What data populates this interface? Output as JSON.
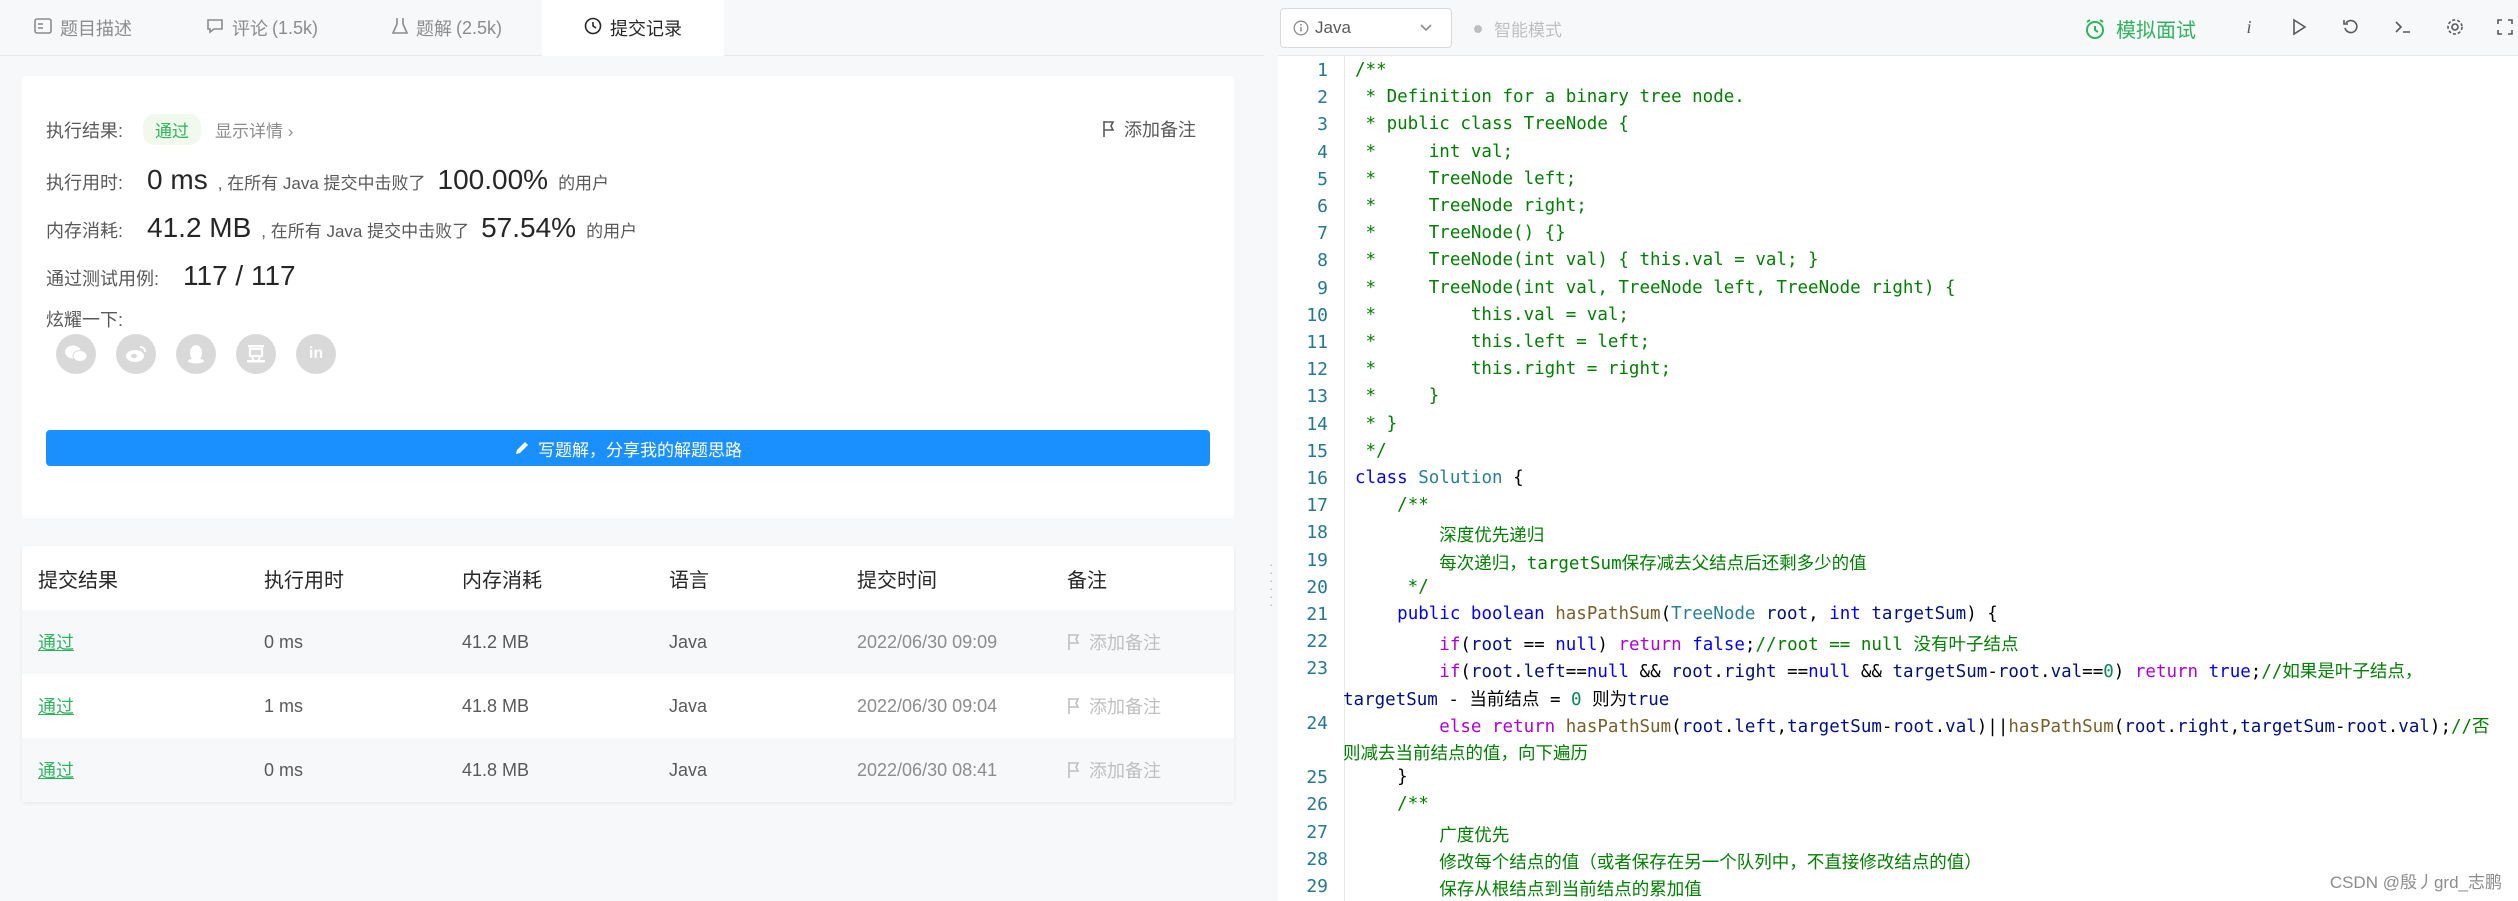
{
  "tabs": [
    {
      "label": "题目描述",
      "count": ""
    },
    {
      "label": "评论",
      "count": "(1.5k)"
    },
    {
      "label": "题解",
      "count": "(2.5k)"
    },
    {
      "label": "提交记录",
      "count": ""
    }
  ],
  "result": {
    "status_label": "执行结果:",
    "status_value": "通过",
    "detail_link": "显示详情 ›",
    "add_note": "添加备注",
    "runtime_label": "执行用时:",
    "runtime_value": "0 ms",
    "runtime_text": ", 在所有 Java 提交中击败了",
    "runtime_pct": "100.00%",
    "runtime_suffix": "的用户",
    "memory_label": "内存消耗:",
    "memory_value": "41.2 MB",
    "memory_text": ", 在所有 Java 提交中击败了",
    "memory_pct": "57.54%",
    "memory_suffix": "的用户",
    "tests_label": "通过测试用例:",
    "tests_value": "117 / 117",
    "share_label": "炫耀一下:",
    "write_button": "写题解，分享我的解题思路"
  },
  "share_icons": [
    "wechat-icon",
    "weibo-icon",
    "qq-icon",
    "douban-icon",
    "linkedin-icon"
  ],
  "table": {
    "headers": [
      "提交结果",
      "执行用时",
      "内存消耗",
      "语言",
      "提交时间",
      "备注"
    ],
    "rows": [
      {
        "result": "通过",
        "time": "0 ms",
        "memory": "41.2 MB",
        "lang": "Java",
        "submitted": "2022/06/30 09:09",
        "note": "添加备注"
      },
      {
        "result": "通过",
        "time": "1 ms",
        "memory": "41.8 MB",
        "lang": "Java",
        "submitted": "2022/06/30 09:04",
        "note": "添加备注"
      },
      {
        "result": "通过",
        "time": "0 ms",
        "memory": "41.8 MB",
        "lang": "Java",
        "submitted": "2022/06/30 08:41",
        "note": "添加备注"
      }
    ]
  },
  "editor": {
    "language": "Java",
    "smart_mode": "智能模式",
    "mock_interview": "模拟面试",
    "watermark": "CSDN @殷丿grd_志鹏"
  },
  "colors": {
    "accent_green": "#2db55d",
    "button_blue": "#1a90ff"
  }
}
